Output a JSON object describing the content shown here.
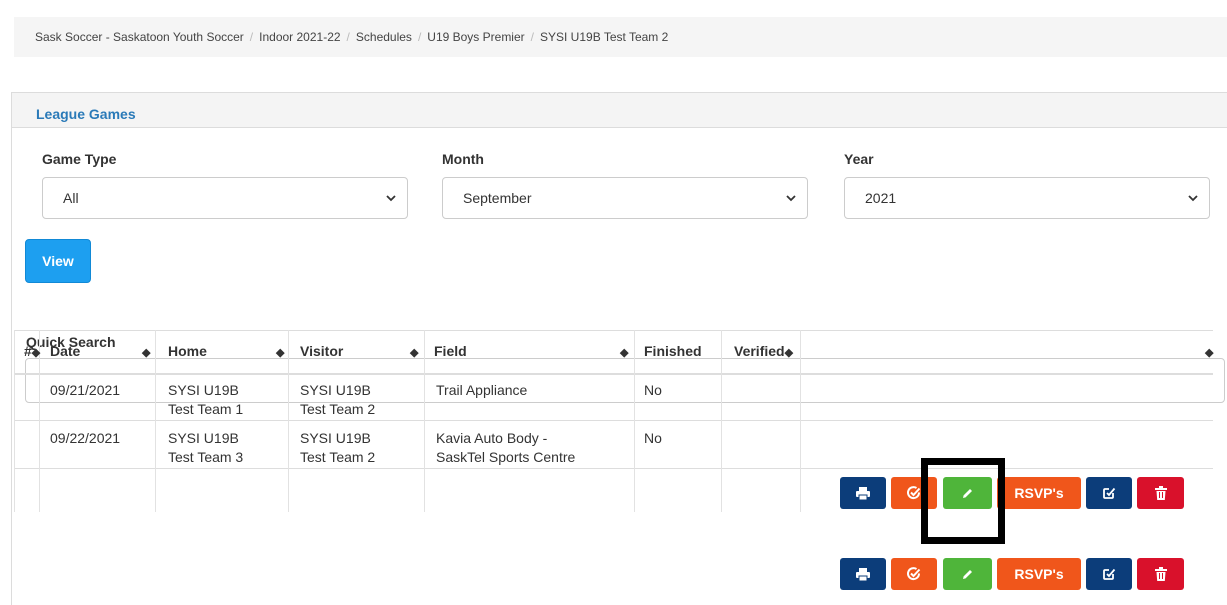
{
  "breadcrumb": [
    "Sask Soccer - Saskatoon Youth Soccer",
    "Indoor 2021-22",
    "Schedules",
    "U19 Boys Premier",
    "SYSI U19B Test Team 2"
  ],
  "breadcrumb_separator": "/",
  "panel": {
    "title": "League Games"
  },
  "filters": {
    "game_type": {
      "label": "Game Type",
      "value": "All"
    },
    "month": {
      "label": "Month",
      "value": "September"
    },
    "year": {
      "label": "Year",
      "value": "2021"
    },
    "view_label": "View"
  },
  "quick_search": {
    "label": "Quick Search",
    "value": ""
  },
  "table": {
    "headers": {
      "num": "#",
      "date": "Date",
      "home": "Home",
      "visitor": "Visitor",
      "field": "Field",
      "finished": "Finished",
      "verified": "Verified"
    },
    "rows": [
      {
        "date": "09/21/2021",
        "home_1": "SYSI U19B",
        "home_2": "Test Team 1",
        "visitor_1": "SYSI U19B",
        "visitor_2": "Test Team 2",
        "field_1": "Trail Appliance",
        "field_2": "",
        "finished": "No",
        "verified": ""
      },
      {
        "date": "09/22/2021",
        "home_1": "SYSI U19B",
        "home_2": "Test Team 3",
        "visitor_1": "SYSI U19B",
        "visitor_2": "Test Team 2",
        "field_1": "Kavia Auto Body -",
        "field_2": "SaskTel Sports Centre",
        "finished": "No",
        "verified": ""
      }
    ],
    "rsvp_label": "RSVP's"
  },
  "colors": {
    "link_blue": "#2a7ab8",
    "view_blue": "#1d9ff0",
    "navy": "#0c3d7a",
    "orange": "#f0561b",
    "green": "#4fb53a",
    "red": "#d9112b"
  },
  "icons": [
    "print-icon",
    "check-circle-icon",
    "pencil-icon",
    "edit-check-icon",
    "trash-icon",
    "chevron-down-icon",
    "sort-icon"
  ]
}
